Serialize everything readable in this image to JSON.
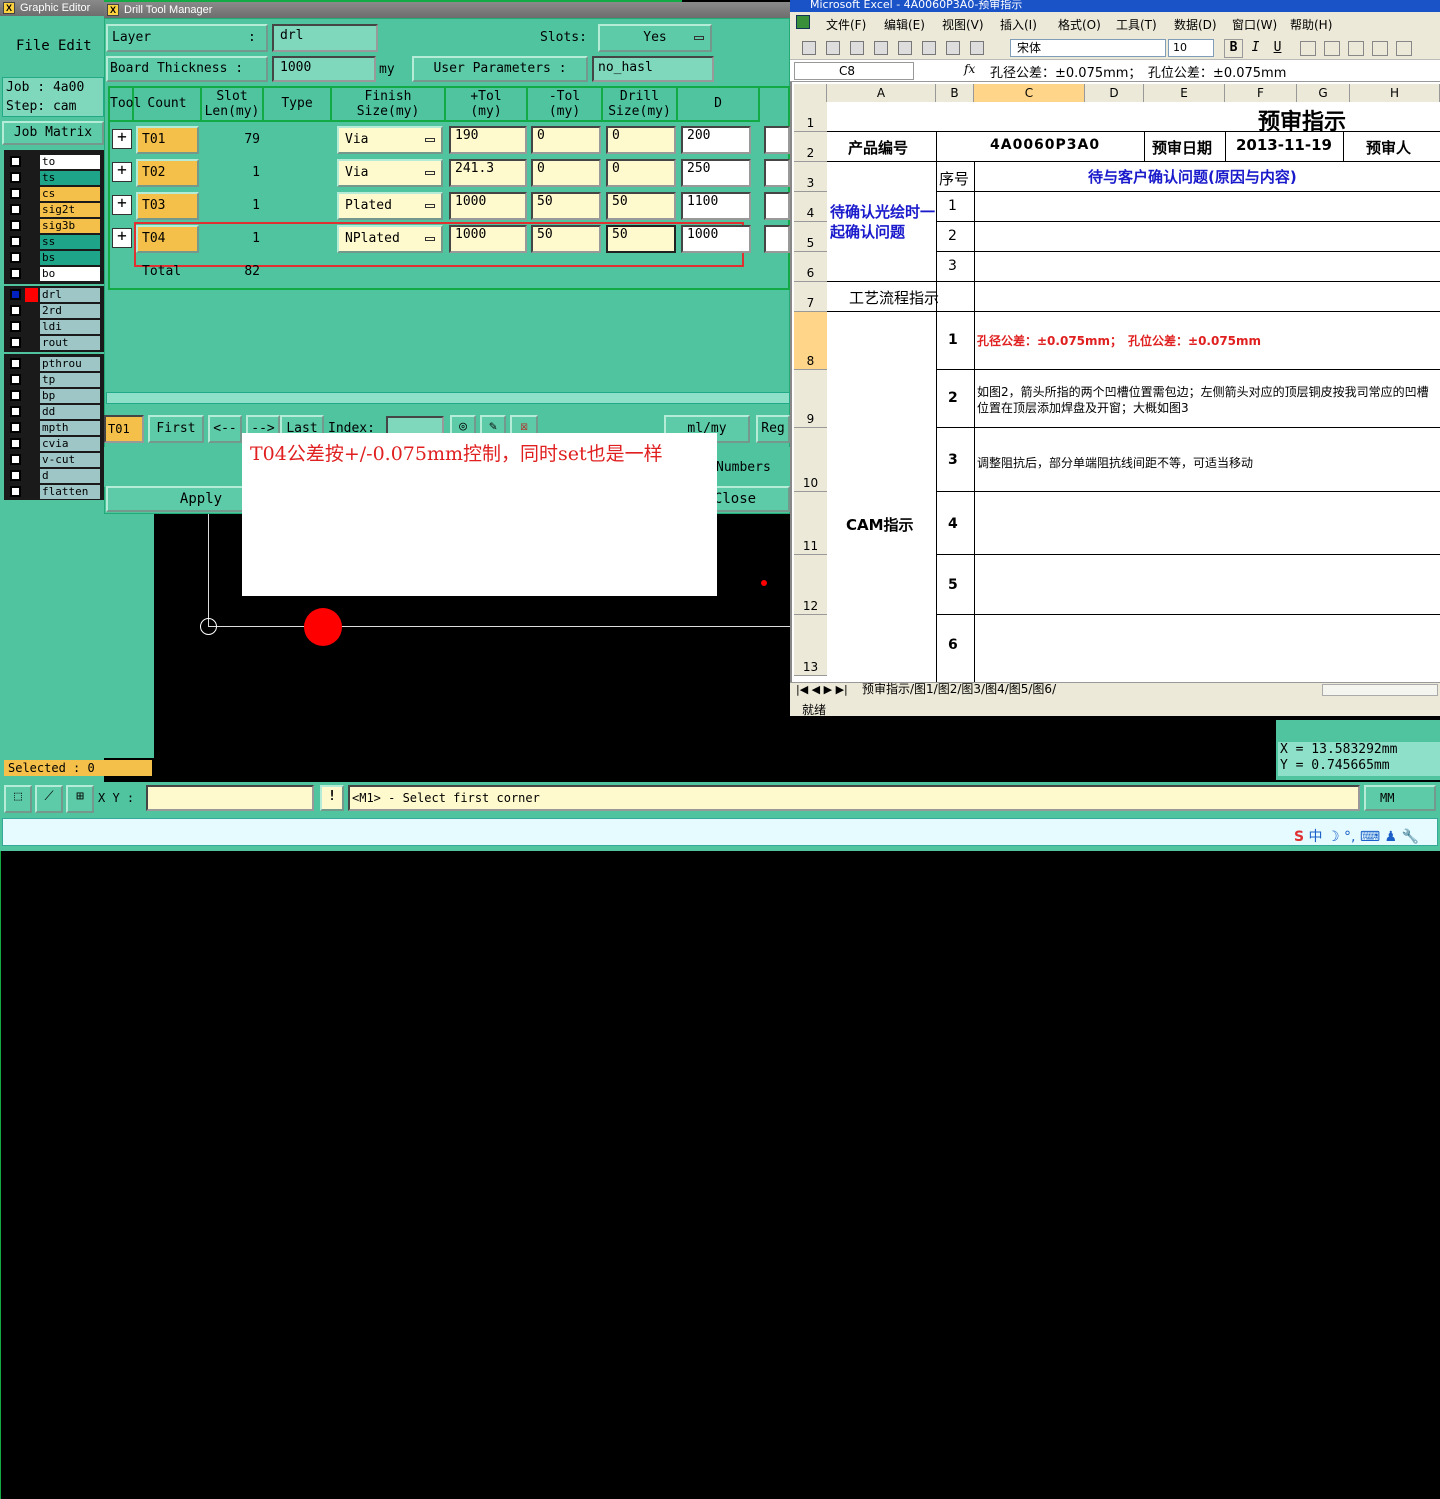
{
  "graphic_editor": {
    "title": "Graphic Editor",
    "menu": [
      "File",
      "Edit"
    ],
    "job": "Job : 4a00",
    "step": "Step: cam",
    "job_matrix": "Job Matrix",
    "selected": "Selected : 0"
  },
  "layers": [
    {
      "name": "to",
      "color": "#ffffff"
    },
    {
      "name": "ts",
      "color": "#1ea488"
    },
    {
      "name": "cs",
      "color": "#f5c04a"
    },
    {
      "name": "sig2t",
      "color": "#f5c04a"
    },
    {
      "name": "sig3b",
      "color": "#f5c04a"
    },
    {
      "name": "ss",
      "color": "#1ea488"
    },
    {
      "name": "bs",
      "color": "#1ea488"
    },
    {
      "name": "bo",
      "color": "#ffffff"
    },
    {
      "name": "drl",
      "color": "#9ec6c6"
    },
    {
      "name": "2rd",
      "color": "#9ec6c6"
    },
    {
      "name": "ldi",
      "color": "#9ec6c6"
    },
    {
      "name": "rout",
      "color": "#9ec6c6"
    },
    {
      "name": "pthrou",
      "color": "#9ec6c6"
    },
    {
      "name": "tp",
      "color": "#9ec6c6"
    },
    {
      "name": "bp",
      "color": "#9ec6c6"
    },
    {
      "name": "dd",
      "color": "#9ec6c6"
    },
    {
      "name": "mpth",
      "color": "#9ec6c6"
    },
    {
      "name": "cvia",
      "color": "#9ec6c6"
    },
    {
      "name": "v-cut",
      "color": "#9ec6c6"
    },
    {
      "name": "d",
      "color": "#9ec6c6"
    },
    {
      "name": "flatten",
      "color": "#9ec6c6"
    }
  ],
  "drill": {
    "title": "Drill Tool Manager",
    "layer_label": "Layer",
    "layer_value": "drl",
    "slots_label": "Slots:",
    "slots_value": "Yes",
    "thickness_label": "Board Thickness :",
    "thickness_value": "1000",
    "thickness_unit": "my",
    "user_params_label": "User Parameters :",
    "user_params_value": "no_hasl",
    "headers": [
      "Tool",
      "Count",
      "Slot\nLen(my)",
      "Type",
      "Finish\nSize(my)",
      "+Tol\n(my)",
      "-Tol\n(my)",
      "Drill\nSize(my)",
      "D"
    ],
    "rows": [
      {
        "tool": "T01",
        "count": "79",
        "type": "Via",
        "finish": "190",
        "ptol": "0",
        "ntol": "0",
        "drill": "200"
      },
      {
        "tool": "T02",
        "count": "1",
        "type": "Via",
        "finish": "241.3",
        "ptol": "0",
        "ntol": "0",
        "drill": "250"
      },
      {
        "tool": "T03",
        "count": "1",
        "type": "Plated",
        "finish": "1000",
        "ptol": "50",
        "ntol": "50",
        "drill": "1100"
      },
      {
        "tool": "T04",
        "count": "1",
        "type": "NPlated",
        "finish": "1000",
        "ptol": "50",
        "ntol": "50",
        "drill": "1000"
      }
    ],
    "total_label": "Total",
    "total_value": "82",
    "current_tool": "T01",
    "first": "First",
    "prev": "<--",
    "next": "-->",
    "last": "Last",
    "index": "Index:",
    "units": "ml/my",
    "reg": "Reg",
    "numbers": "Numbers",
    "apply": "Apply",
    "close": "Close"
  },
  "annotation": "T04公差按+/-0.075mm控制，同时set也是一样",
  "status": {
    "xy_label": "X Y :",
    "prompt": "<M1> - Select first corner",
    "units": "MM",
    "x": "X  =  13.583292mm",
    "y": "Y  =  0.745665mm"
  },
  "excel": {
    "title": "Microsoft Excel - 4A0060P3A0-预审指示",
    "menu": [
      "文件(F)",
      "编辑(E)",
      "视图(V)",
      "插入(I)",
      "格式(O)",
      "工具(T)",
      "数据(D)",
      "窗口(W)",
      "帮助(H)"
    ],
    "font": "宋体",
    "size": "10",
    "cell_ref": "C8",
    "fx": "fx",
    "formula": "孔径公差：±0.075mm；　孔位公差：±0.075mm",
    "cols": [
      "A",
      "B",
      "C",
      "D",
      "E",
      "F",
      "G",
      "H"
    ],
    "rows": [
      "1",
      "2",
      "3",
      "4",
      "5",
      "6",
      "7",
      "8",
      "9",
      "10",
      "11",
      "12",
      "13"
    ],
    "title_cell": "预审指示",
    "product_label": "产品编号",
    "product_value": "4A0060P3A0",
    "date_label": "预审日期",
    "date_value": "2013-11-19",
    "reviewer_label": "预审人",
    "seq_label": "序号",
    "customer_header": "待与客户确认问题(原因与内容)",
    "confirm_label": "待确认光绘时一起确认问题",
    "process_label": "工艺流程指示",
    "cam_label": "CAM指示",
    "nums": [
      "1",
      "2",
      "3",
      "1",
      "2",
      "3",
      "4",
      "5",
      "6"
    ],
    "item1": "孔径公差：±0.075mm；　孔位公差：±0.075mm",
    "item2": "如图2，箭头所指的两个凹槽位置需包边；左侧箭头对应的顶层铜皮按我司常应的凹槽位置在顶层添加焊盘及开窗；大概如图3",
    "item3": "调整阻抗后，部分单端阻抗线间距不等，可适当移动",
    "sheets": "预审指示/图1/图2/图3/图4/图5/图6/",
    "ready": "就绪"
  }
}
